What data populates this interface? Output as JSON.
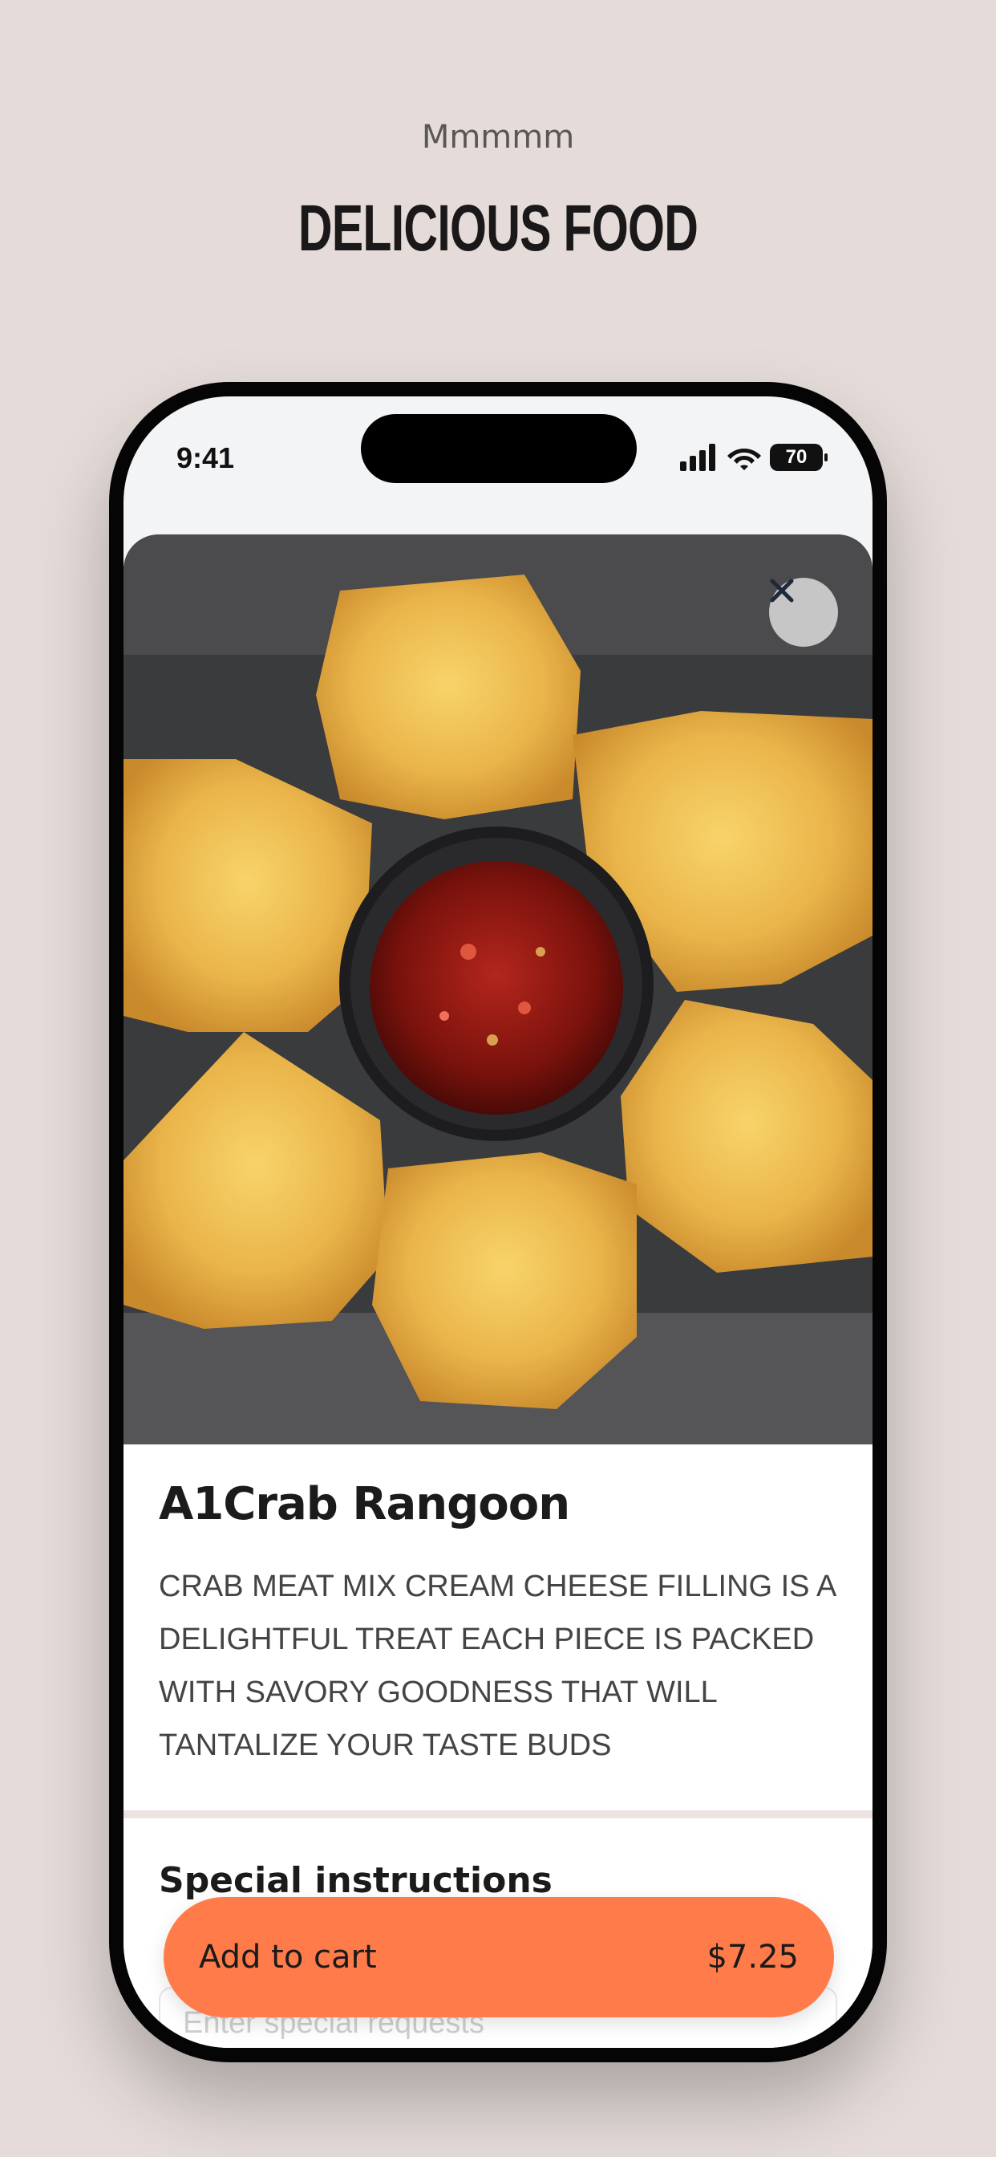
{
  "header": {
    "eyebrow": "Mmmmm",
    "headline": "DELICIOUS FOOD"
  },
  "status_bar": {
    "time": "9:41",
    "battery": "70"
  },
  "item": {
    "title": "A1Crab Rangoon",
    "description": "CRAB MEAT MIX CREAM CHEESE FILLING IS A DELIGHTFUL TREAT EACH PIECE IS PACKED WITH SAVORY GOODNESS THAT WILL TANTALIZE YOUR TASTE BUDS"
  },
  "instructions": {
    "label": "Special instructions",
    "placeholder": "Enter special requests"
  },
  "cart": {
    "label": "Add to cart",
    "price": "$7.25"
  },
  "colors": {
    "accent": "#ff7b4a",
    "background": "#e5dcd9"
  },
  "icons": {
    "close": "close-icon",
    "signal": "signal-icon",
    "wifi": "wifi-icon",
    "battery": "battery-icon"
  }
}
